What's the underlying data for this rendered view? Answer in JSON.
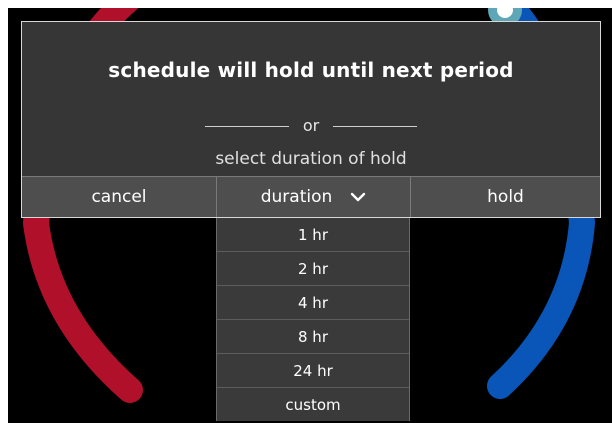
{
  "dialog": {
    "title": "schedule will hold until next period",
    "or_text": "or",
    "subtitle": "select duration of hold",
    "buttons": {
      "cancel": "cancel",
      "duration": "duration",
      "hold": "hold"
    }
  },
  "duration_menu": {
    "options": [
      "1 hr",
      "2 hr",
      "4 hr",
      "8 hr",
      "24 hr",
      "custom"
    ]
  },
  "colors": {
    "heat_arc": "#b0102a",
    "cool_arc": "#0a56b8",
    "dialog_bg": "#363636",
    "button_bg": "#4e4e4e"
  },
  "icons": {
    "duration_toggle": "chevron-down-icon"
  }
}
